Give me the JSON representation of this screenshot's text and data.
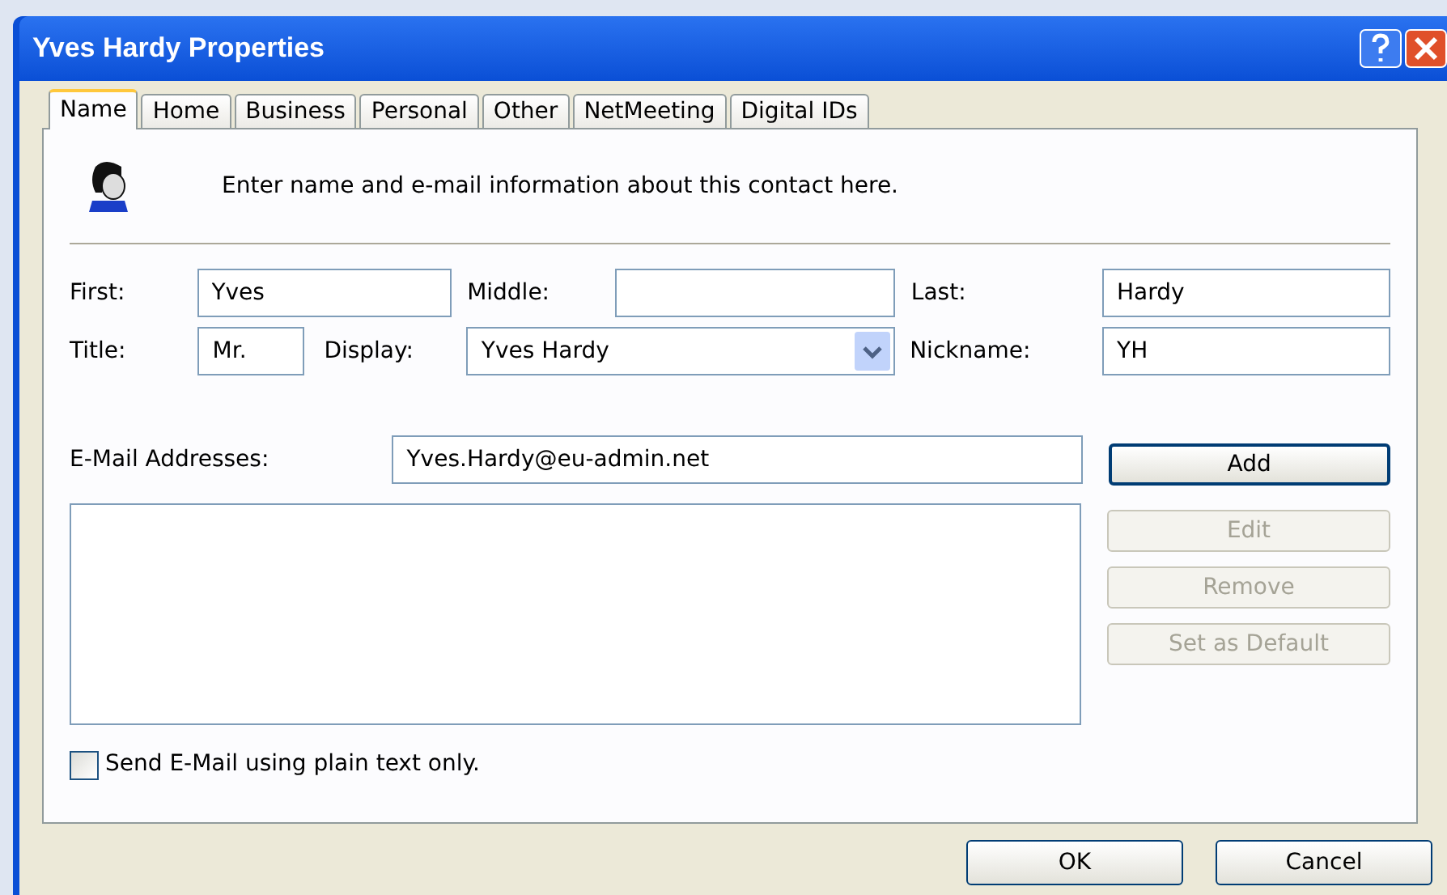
{
  "window": {
    "title": "Yves Hardy Properties"
  },
  "tabs": [
    {
      "label": "Name",
      "selected": true
    },
    {
      "label": "Home",
      "selected": false
    },
    {
      "label": "Business",
      "selected": false
    },
    {
      "label": "Personal",
      "selected": false
    },
    {
      "label": "Other",
      "selected": false
    },
    {
      "label": "NetMeeting",
      "selected": false
    },
    {
      "label": "Digital IDs",
      "selected": false
    }
  ],
  "intro": "Enter name and e-mail information about this contact here.",
  "fields": {
    "first": {
      "label": "First:",
      "value": "Yves"
    },
    "middle": {
      "label": "Middle:"
    },
    "last": {
      "label": "Last:",
      "value": "Hardy"
    },
    "title": {
      "label": "Title:",
      "value": "Mr."
    },
    "display": {
      "label": "Display:",
      "value": "Yves Hardy"
    },
    "nickname": {
      "label": "Nickname:",
      "value": "YH"
    }
  },
  "email": {
    "label": "E-Mail Addresses:",
    "value": "Yves.Hardy@eu-admin.net"
  },
  "email_buttons": [
    {
      "label": "Add",
      "disabled": false
    },
    {
      "label": "Edit",
      "disabled": true
    },
    {
      "label": "Remove",
      "disabled": true
    },
    {
      "label": "Set as Default",
      "disabled": true
    }
  ],
  "plain_text": {
    "label": "Send E-Mail using plain text only.",
    "checked": false
  },
  "buttons": [
    {
      "label": "OK"
    },
    {
      "label": "Cancel"
    }
  ]
}
